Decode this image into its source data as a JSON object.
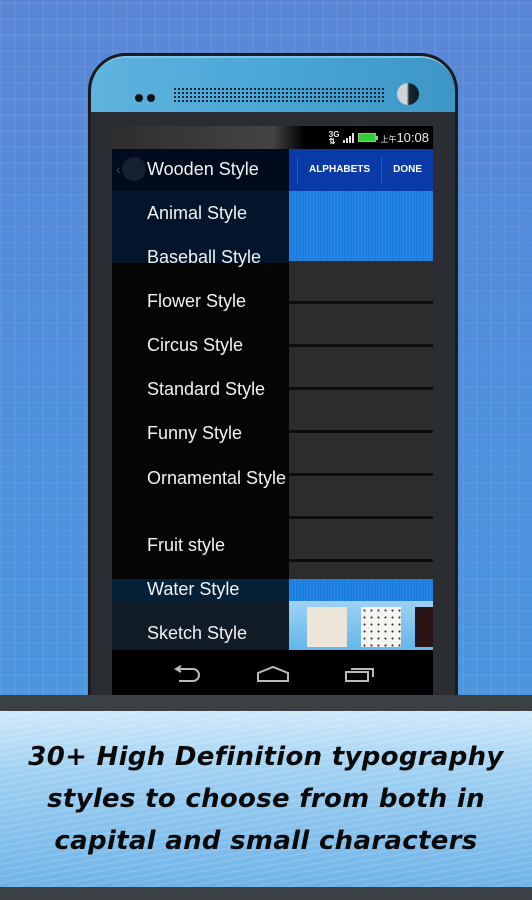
{
  "status_bar": {
    "network": "3G",
    "time_prefix": "上午",
    "time": "10:08"
  },
  "action_bar": {
    "title": "Wooden Style",
    "alphabets_label": "ALPHABETS",
    "done_label": "DONE"
  },
  "drawer": {
    "items": [
      {
        "label": "Wooden Style"
      },
      {
        "label": "Animal Style"
      },
      {
        "label": "Baseball Style"
      },
      {
        "label": "Flower Style"
      },
      {
        "label": "Circus Style"
      },
      {
        "label": "Standard Style"
      },
      {
        "label": "Funny Style"
      },
      {
        "label": "Ornamental Style"
      },
      {
        "label": "Fruit style"
      },
      {
        "label": "Water Style"
      },
      {
        "label": "Sketch Style"
      }
    ]
  },
  "navbar": {
    "back_icon": "back-icon",
    "home_icon": "home-icon",
    "recents_icon": "recents-icon"
  },
  "caption": {
    "line1": "30+ High Definition typography",
    "line2": "styles to choose from both in",
    "line3": "capital and small characters"
  },
  "colors": {
    "action_bar": "#0a3aa8",
    "accent_blue": "#1a7de0",
    "phone_bezel": "#4aa6d6"
  }
}
